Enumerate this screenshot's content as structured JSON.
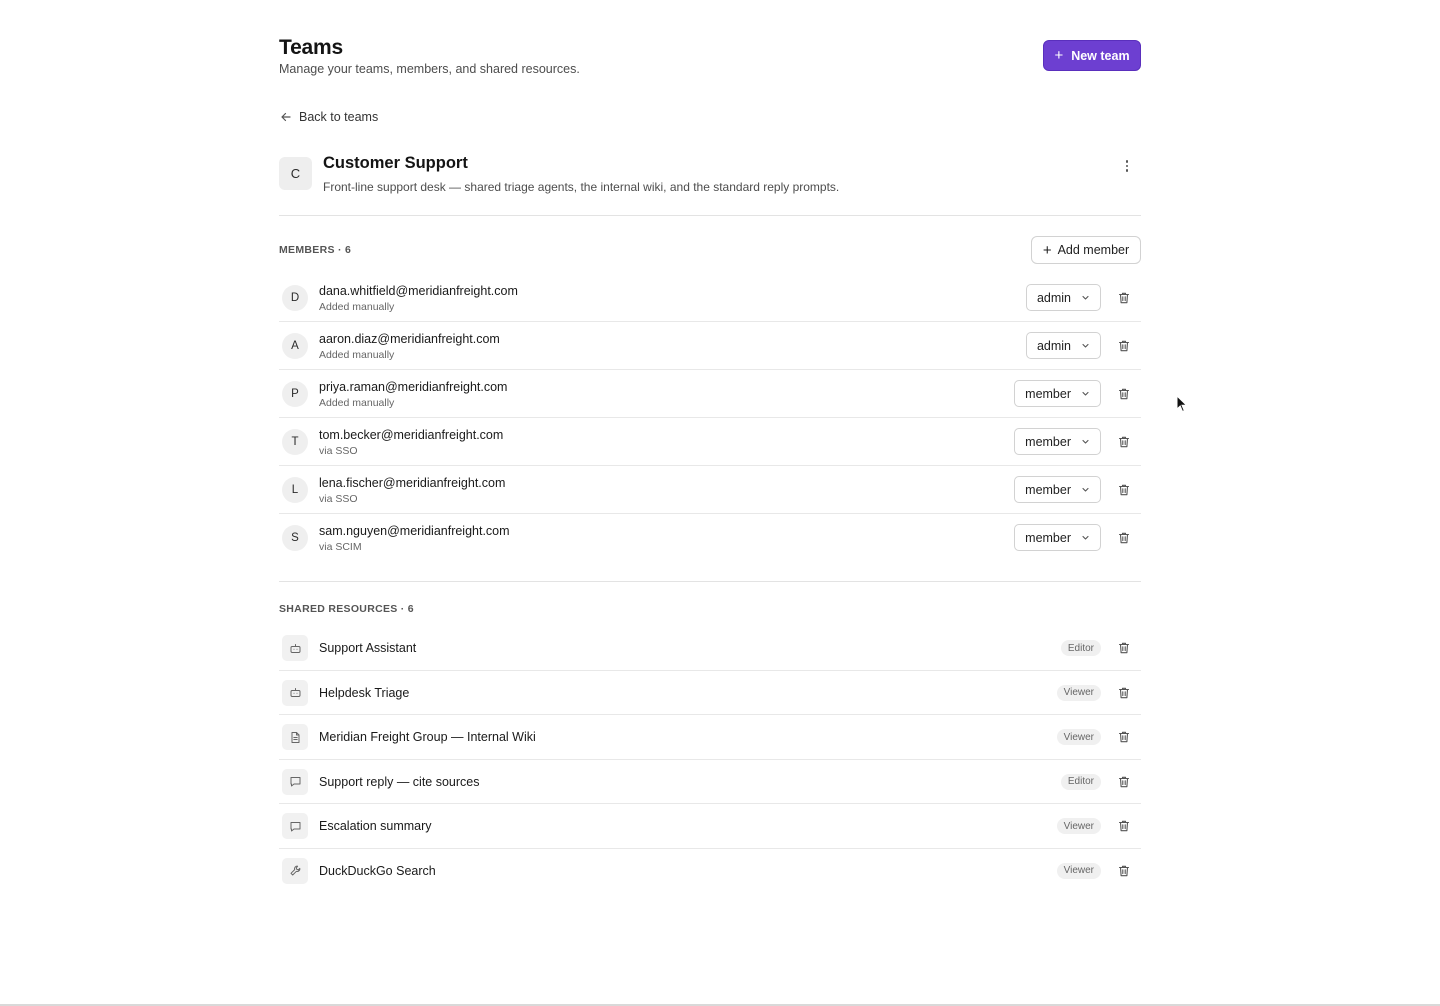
{
  "header": {
    "title": "Teams",
    "subtitle": "Manage your teams, members, and shared resources.",
    "new_team_label": "New team"
  },
  "back_label": "Back to teams",
  "team": {
    "initial": "C",
    "name": "Customer Support",
    "description": "Front-line support desk — shared triage agents, the internal wiki, and the standard reply prompts."
  },
  "members": {
    "label": "MEMBERS · 6",
    "add_label": "Add member",
    "items": [
      {
        "initial": "D",
        "email": "dana.whitfield@meridianfreight.com",
        "source": "Added manually",
        "role": "admin"
      },
      {
        "initial": "A",
        "email": "aaron.diaz@meridianfreight.com",
        "source": "Added manually",
        "role": "admin"
      },
      {
        "initial": "P",
        "email": "priya.raman@meridianfreight.com",
        "source": "Added manually",
        "role": "member"
      },
      {
        "initial": "T",
        "email": "tom.becker@meridianfreight.com",
        "source": "via SSO",
        "role": "member"
      },
      {
        "initial": "L",
        "email": "lena.fischer@meridianfreight.com",
        "source": "via SSO",
        "role": "member"
      },
      {
        "initial": "S",
        "email": "sam.nguyen@meridianfreight.com",
        "source": "via SCIM",
        "role": "member"
      }
    ]
  },
  "resources": {
    "label": "SHARED RESOURCES · 6",
    "items": [
      {
        "icon": "bot-icon",
        "name": "Support Assistant",
        "permission": "Editor"
      },
      {
        "icon": "bot-icon",
        "name": "Helpdesk Triage",
        "permission": "Viewer"
      },
      {
        "icon": "document-icon",
        "name": "Meridian Freight Group — Internal Wiki",
        "permission": "Viewer"
      },
      {
        "icon": "message-icon",
        "name": "Support reply — cite sources",
        "permission": "Editor"
      },
      {
        "icon": "message-icon",
        "name": "Escalation summary",
        "permission": "Viewer"
      },
      {
        "icon": "wrench-icon",
        "name": "DuckDuckGo Search",
        "permission": "Viewer"
      }
    ]
  },
  "colors": {
    "accent": "#6d3fd1",
    "border": "#d2d2d2",
    "muted_text": "#666666"
  }
}
